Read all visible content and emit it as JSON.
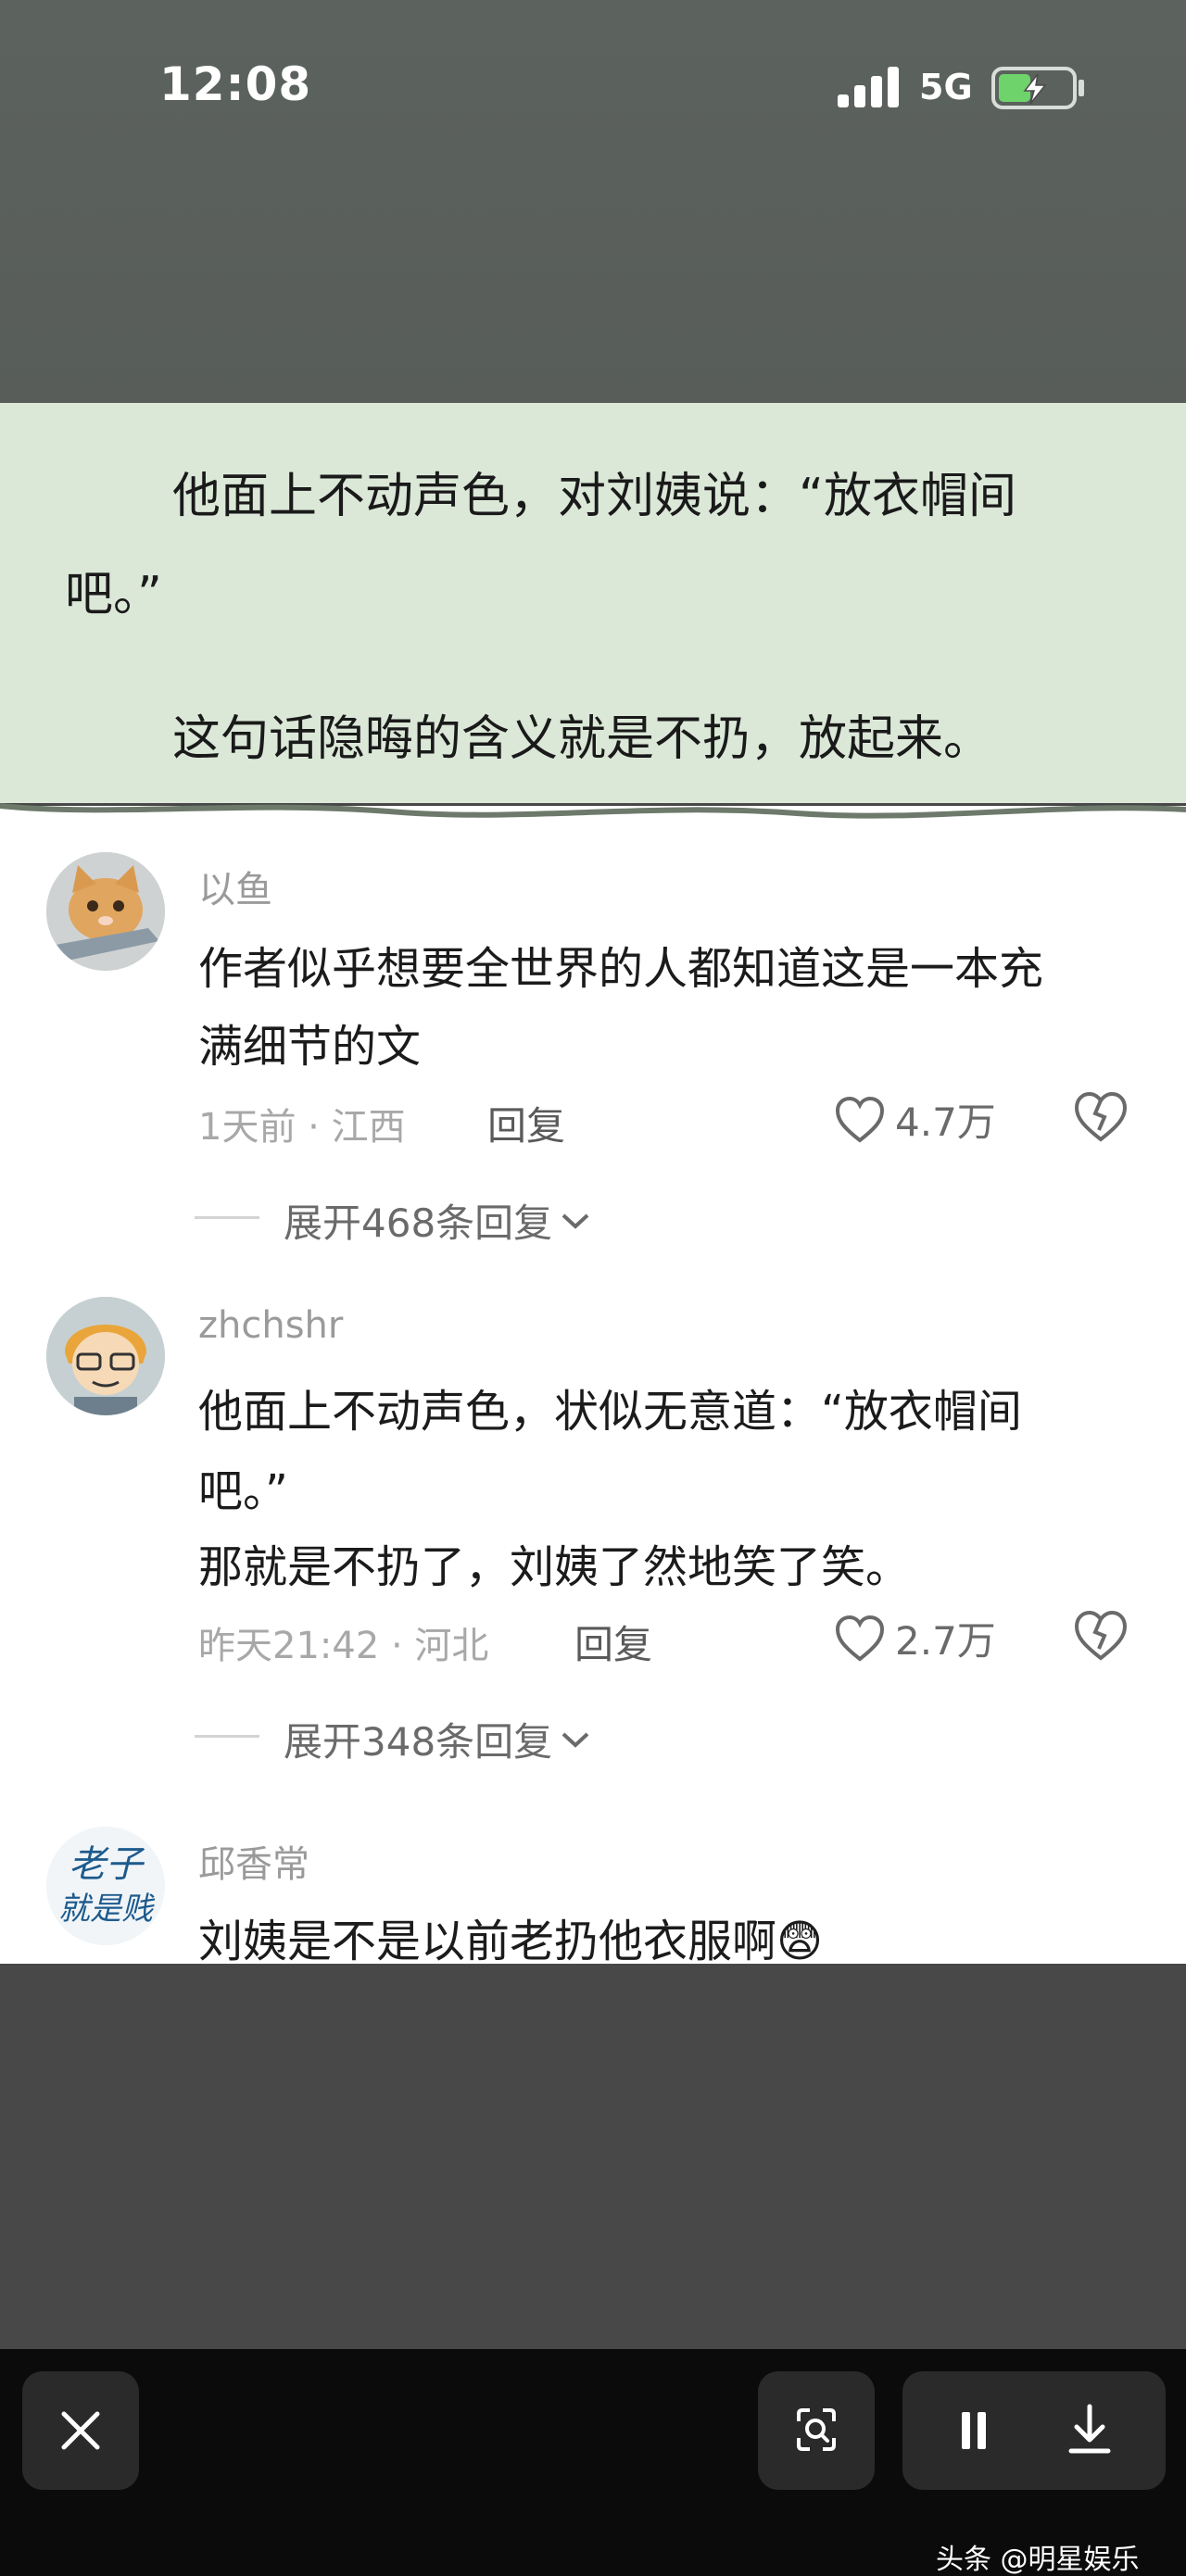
{
  "status_bar": {
    "time": "12:08",
    "network": "5G"
  },
  "excerpt": {
    "line1": "他面上不动声色，对刘姨说：“放衣帽间",
    "line2": "吧。”",
    "line3": "这句话隐晦的含义就是不扔，放起来。"
  },
  "comments": [
    {
      "username": "以鱼",
      "text_lines": [
        "作者似乎想要全世界的人都知道这是一本充",
        "满细节的文"
      ],
      "meta": "1天前 · 江西",
      "reply": "回复",
      "likes": "4.7万",
      "expand": "展开468条回复"
    },
    {
      "username": "zhchshr",
      "text_lines": [
        "他面上不动声色，状似无意道：“放衣帽间",
        "吧。”",
        "那就是不扔了，刘姨了然地笑了笑。"
      ],
      "meta": "昨天21:42 · 河北",
      "reply": "回复",
      "likes": "2.7万",
      "expand": "展开348条回复"
    },
    {
      "username": "邱香常",
      "avatar_text": [
        "老子",
        "就是贱"
      ],
      "text_lines": [
        "刘姨是不是以前老扔他衣服啊"
      ],
      "emoji": "😨"
    }
  ],
  "watermark": "头条 @明星娱乐",
  "icons": {
    "close": "close-icon",
    "scan": "scan-icon",
    "pause": "pause-icon",
    "download": "download-icon",
    "heart": "heart-icon",
    "dislike": "broken-heart-icon"
  }
}
